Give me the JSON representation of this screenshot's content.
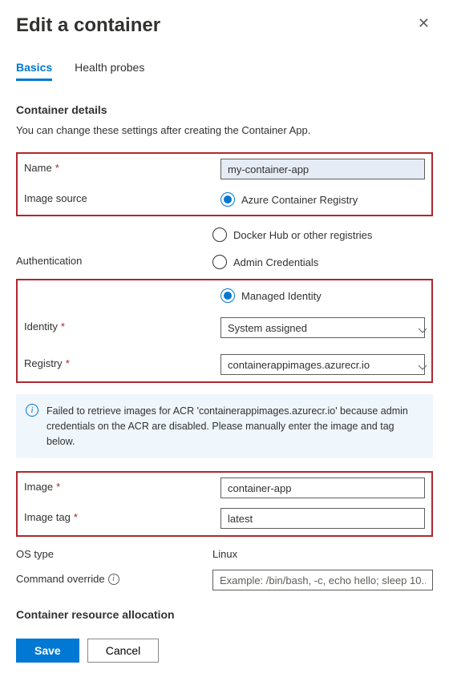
{
  "header": {
    "title": "Edit a container"
  },
  "tabs": {
    "basics": "Basics",
    "health_probes": "Health probes"
  },
  "section": {
    "title": "Container details",
    "desc": "You can change these settings after creating the Container App.",
    "resource_title": "Container resource allocation"
  },
  "labels": {
    "name": "Name",
    "image_source": "Image source",
    "authentication": "Authentication",
    "identity": "Identity",
    "registry": "Registry",
    "image": "Image",
    "image_tag": "Image tag",
    "os_type": "OS type",
    "command_override": "Command override"
  },
  "values": {
    "name": "my-container-app",
    "identity": "System assigned",
    "registry": "containerappimages.azurecr.io",
    "image": "container-app",
    "image_tag": "latest",
    "os_type": "Linux"
  },
  "radios": {
    "acr": "Azure Container Registry",
    "docker": "Docker Hub or other registries",
    "admin": "Admin Credentials",
    "managed": "Managed Identity"
  },
  "info": {
    "message": "Failed to retrieve images for ACR 'containerappimages.azurecr.io' because admin credentials on the ACR are disabled. Please manually enter the image and tag below."
  },
  "placeholders": {
    "command": "Example: /bin/bash, -c, echo hello; sleep 10..."
  },
  "buttons": {
    "save": "Save",
    "cancel": "Cancel"
  }
}
